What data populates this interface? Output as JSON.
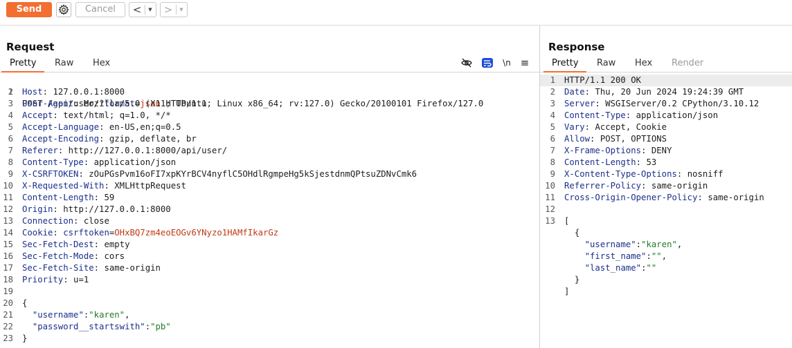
{
  "toolbar": {
    "send_label": "Send",
    "cancel_label": "Cancel",
    "back_label": "<",
    "forward_label": ">",
    "accent": "#f26e31"
  },
  "request": {
    "title": "Request",
    "tabs": [
      "Pretty",
      "Raw",
      "Hex"
    ],
    "active_tab": "Pretty",
    "tool_icons": [
      "hide-icon",
      "wrap-icon",
      "newline-icon",
      "menu-icon"
    ],
    "newline_label": "\\n",
    "menu_label": "≡",
    "request_line": {
      "method": "POST",
      "path": "/api/user/?",
      "param_key": "format",
      "eq": "=",
      "param_val": "json",
      "version": " HTTP/1.1"
    },
    "headers": [
      {
        "n": 2,
        "name": "Host",
        "value": "127.0.0.1:8000"
      },
      {
        "n": 3,
        "name": "User-Agent",
        "value": "Mozilla/5.0 (X11; Ubuntu; Linux x86_64; rv:127.0) Gecko/20100101 Firefox/127.0"
      },
      {
        "n": 4,
        "name": "Accept",
        "value": "text/html; q=1.0, */*"
      },
      {
        "n": 5,
        "name": "Accept-Language",
        "value": "en-US,en;q=0.5"
      },
      {
        "n": 6,
        "name": "Accept-Encoding",
        "value": "gzip, deflate, br"
      },
      {
        "n": 7,
        "name": "Referer",
        "value": "http://127.0.0.1:8000/api/user/"
      },
      {
        "n": 8,
        "name": "Content-Type",
        "value": "application/json"
      },
      {
        "n": 9,
        "name": "X-CSRFTOKEN",
        "value": "zOuPGsPvm16oFI7xpKYrBCV4nyflC5OHdlRgmpeHg5kSjestdnmQPtsuZDNvCmk6"
      },
      {
        "n": 10,
        "name": "X-Requested-With",
        "value": "XMLHttpRequest"
      },
      {
        "n": 11,
        "name": "Content-Length",
        "value": "59"
      },
      {
        "n": 12,
        "name": "Origin",
        "value": "http://127.0.0.1:8000"
      },
      {
        "n": 13,
        "name": "Connection",
        "value": "close"
      }
    ],
    "cookie": {
      "name": "Cookie",
      "key": "csrftoken",
      "value": "OHxBQ7zm4eoEOGv6YNyzo1HAMfIkarGz"
    },
    "headers2": [
      {
        "n": 15,
        "name": "Sec-Fetch-Dest",
        "value": "empty"
      },
      {
        "n": 16,
        "name": "Sec-Fetch-Mode",
        "value": "cors"
      },
      {
        "n": 17,
        "name": "Sec-Fetch-Site",
        "value": "same-origin"
      },
      {
        "n": 18,
        "name": "Priority",
        "value": "u=1"
      }
    ],
    "body": {
      "open": "{",
      "username_key": "\"username\"",
      "username_val": "\"karen\"",
      "password_key": "\"password__startswith\"",
      "password_val": "\"pb\"",
      "close": "}"
    },
    "line_numbers": [
      "1",
      "2",
      "3",
      "4",
      "5",
      "6",
      "7",
      "8",
      "9",
      "10",
      "11",
      "12",
      "13",
      "14",
      "15",
      "16",
      "17",
      "18",
      "19",
      "20",
      "21",
      "22",
      "23"
    ]
  },
  "response": {
    "title": "Response",
    "tabs": [
      "Pretty",
      "Raw",
      "Hex",
      "Render"
    ],
    "active_tab": "Pretty",
    "status_line": "HTTP/1.1 200 OK",
    "headers": [
      {
        "n": 2,
        "name": "Date",
        "value": "Thu, 20 Jun 2024 19:24:39 GMT"
      },
      {
        "n": 3,
        "name": "Server",
        "value": "WSGIServer/0.2 CPython/3.10.12"
      },
      {
        "n": 4,
        "name": "Content-Type",
        "value": "application/json"
      },
      {
        "n": 5,
        "name": "Vary",
        "value": "Accept, Cookie"
      },
      {
        "n": 6,
        "name": "Allow",
        "value": "POST, OPTIONS"
      },
      {
        "n": 7,
        "name": "X-Frame-Options",
        "value": "DENY"
      },
      {
        "n": 8,
        "name": "Content-Length",
        "value": "53"
      },
      {
        "n": 9,
        "name": "X-Content-Type-Options",
        "value": "nosniff"
      },
      {
        "n": 10,
        "name": "Referrer-Policy",
        "value": "same-origin"
      },
      {
        "n": 11,
        "name": "Cross-Origin-Opener-Policy",
        "value": "same-origin"
      }
    ],
    "body": {
      "open_bracket": "[",
      "open_brace": "{",
      "username_key": "\"username\"",
      "username_val": "\"karen\"",
      "first_name_key": "\"first_name\"",
      "first_name_val": "\"\"",
      "last_name_key": "\"last_name\"",
      "last_name_val": "\"\"",
      "close_brace": "}",
      "close_bracket": "]"
    },
    "line_numbers": [
      "1",
      "2",
      "3",
      "4",
      "5",
      "6",
      "7",
      "8",
      "9",
      "10",
      "11",
      "12",
      "13"
    ]
  }
}
